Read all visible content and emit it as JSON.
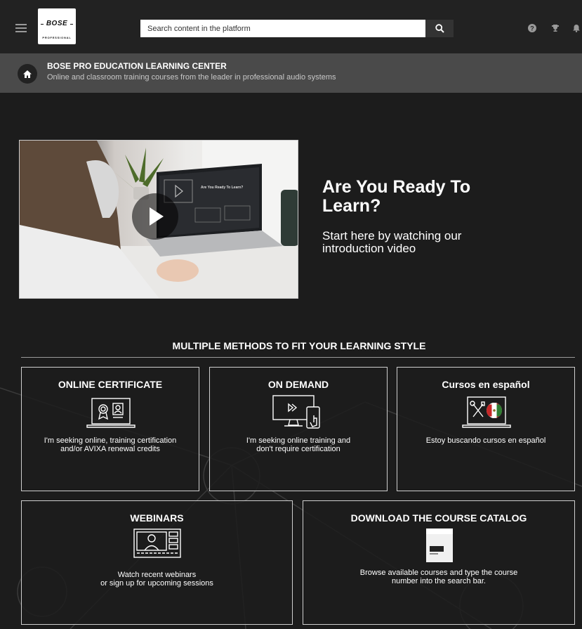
{
  "header": {
    "menu_icon": "hamburger-menu-icon",
    "logo": {
      "brand": "BOSE",
      "sub": "PROFESSIONAL"
    },
    "search": {
      "placeholder": "Search content in the platform",
      "value": ""
    },
    "icons": [
      "search-icon",
      "help-icon",
      "trophy-icon",
      "bell-icon"
    ]
  },
  "banner": {
    "home_icon": "home-icon",
    "title": "BOSE PRO EDUCATION LEARNING CENTER",
    "subtitle": "Online and classroom training courses from the leader in professional audio systems"
  },
  "hero": {
    "title": "Are You Ready To Learn?",
    "subtitle": "Start here by watching our introduction video",
    "video": {
      "screen_title": "Are You Ready To Learn?",
      "play_icon": "play-icon"
    }
  },
  "section": {
    "title": "MULTIPLE METHODS TO FIT YOUR LEARNING STYLE"
  },
  "cards": [
    {
      "title": "ONLINE CERTIFICATE",
      "desc": "I'm seeking online, training certification\nand/or AVIXA renewal credits",
      "icon": "certificate-laptop-icon"
    },
    {
      "title": "ON DEMAND",
      "desc": "I'm seeking online training and\ndon't require certification",
      "icon": "on-demand-devices-icon"
    },
    {
      "title": "Cursos en español",
      "desc": "Estoy buscando cursos en español",
      "icon": "spanish-courses-laptop-icon"
    },
    {
      "title": "WEBINARS",
      "desc": "Watch recent webinars\nor sign up for upcoming sessions",
      "icon": "webinar-screen-icon"
    },
    {
      "title": "DOWNLOAD THE COURSE CATALOG",
      "desc": "Browse available courses and type the course\nnumber into the search bar.",
      "icon": "course-catalog-icon"
    }
  ],
  "colors": {
    "background": "#1c1c1c",
    "topbar": "#222222",
    "banner": "#4a4a4a",
    "accent_red": "#d32f2f",
    "accent_green": "#2e7d32"
  }
}
